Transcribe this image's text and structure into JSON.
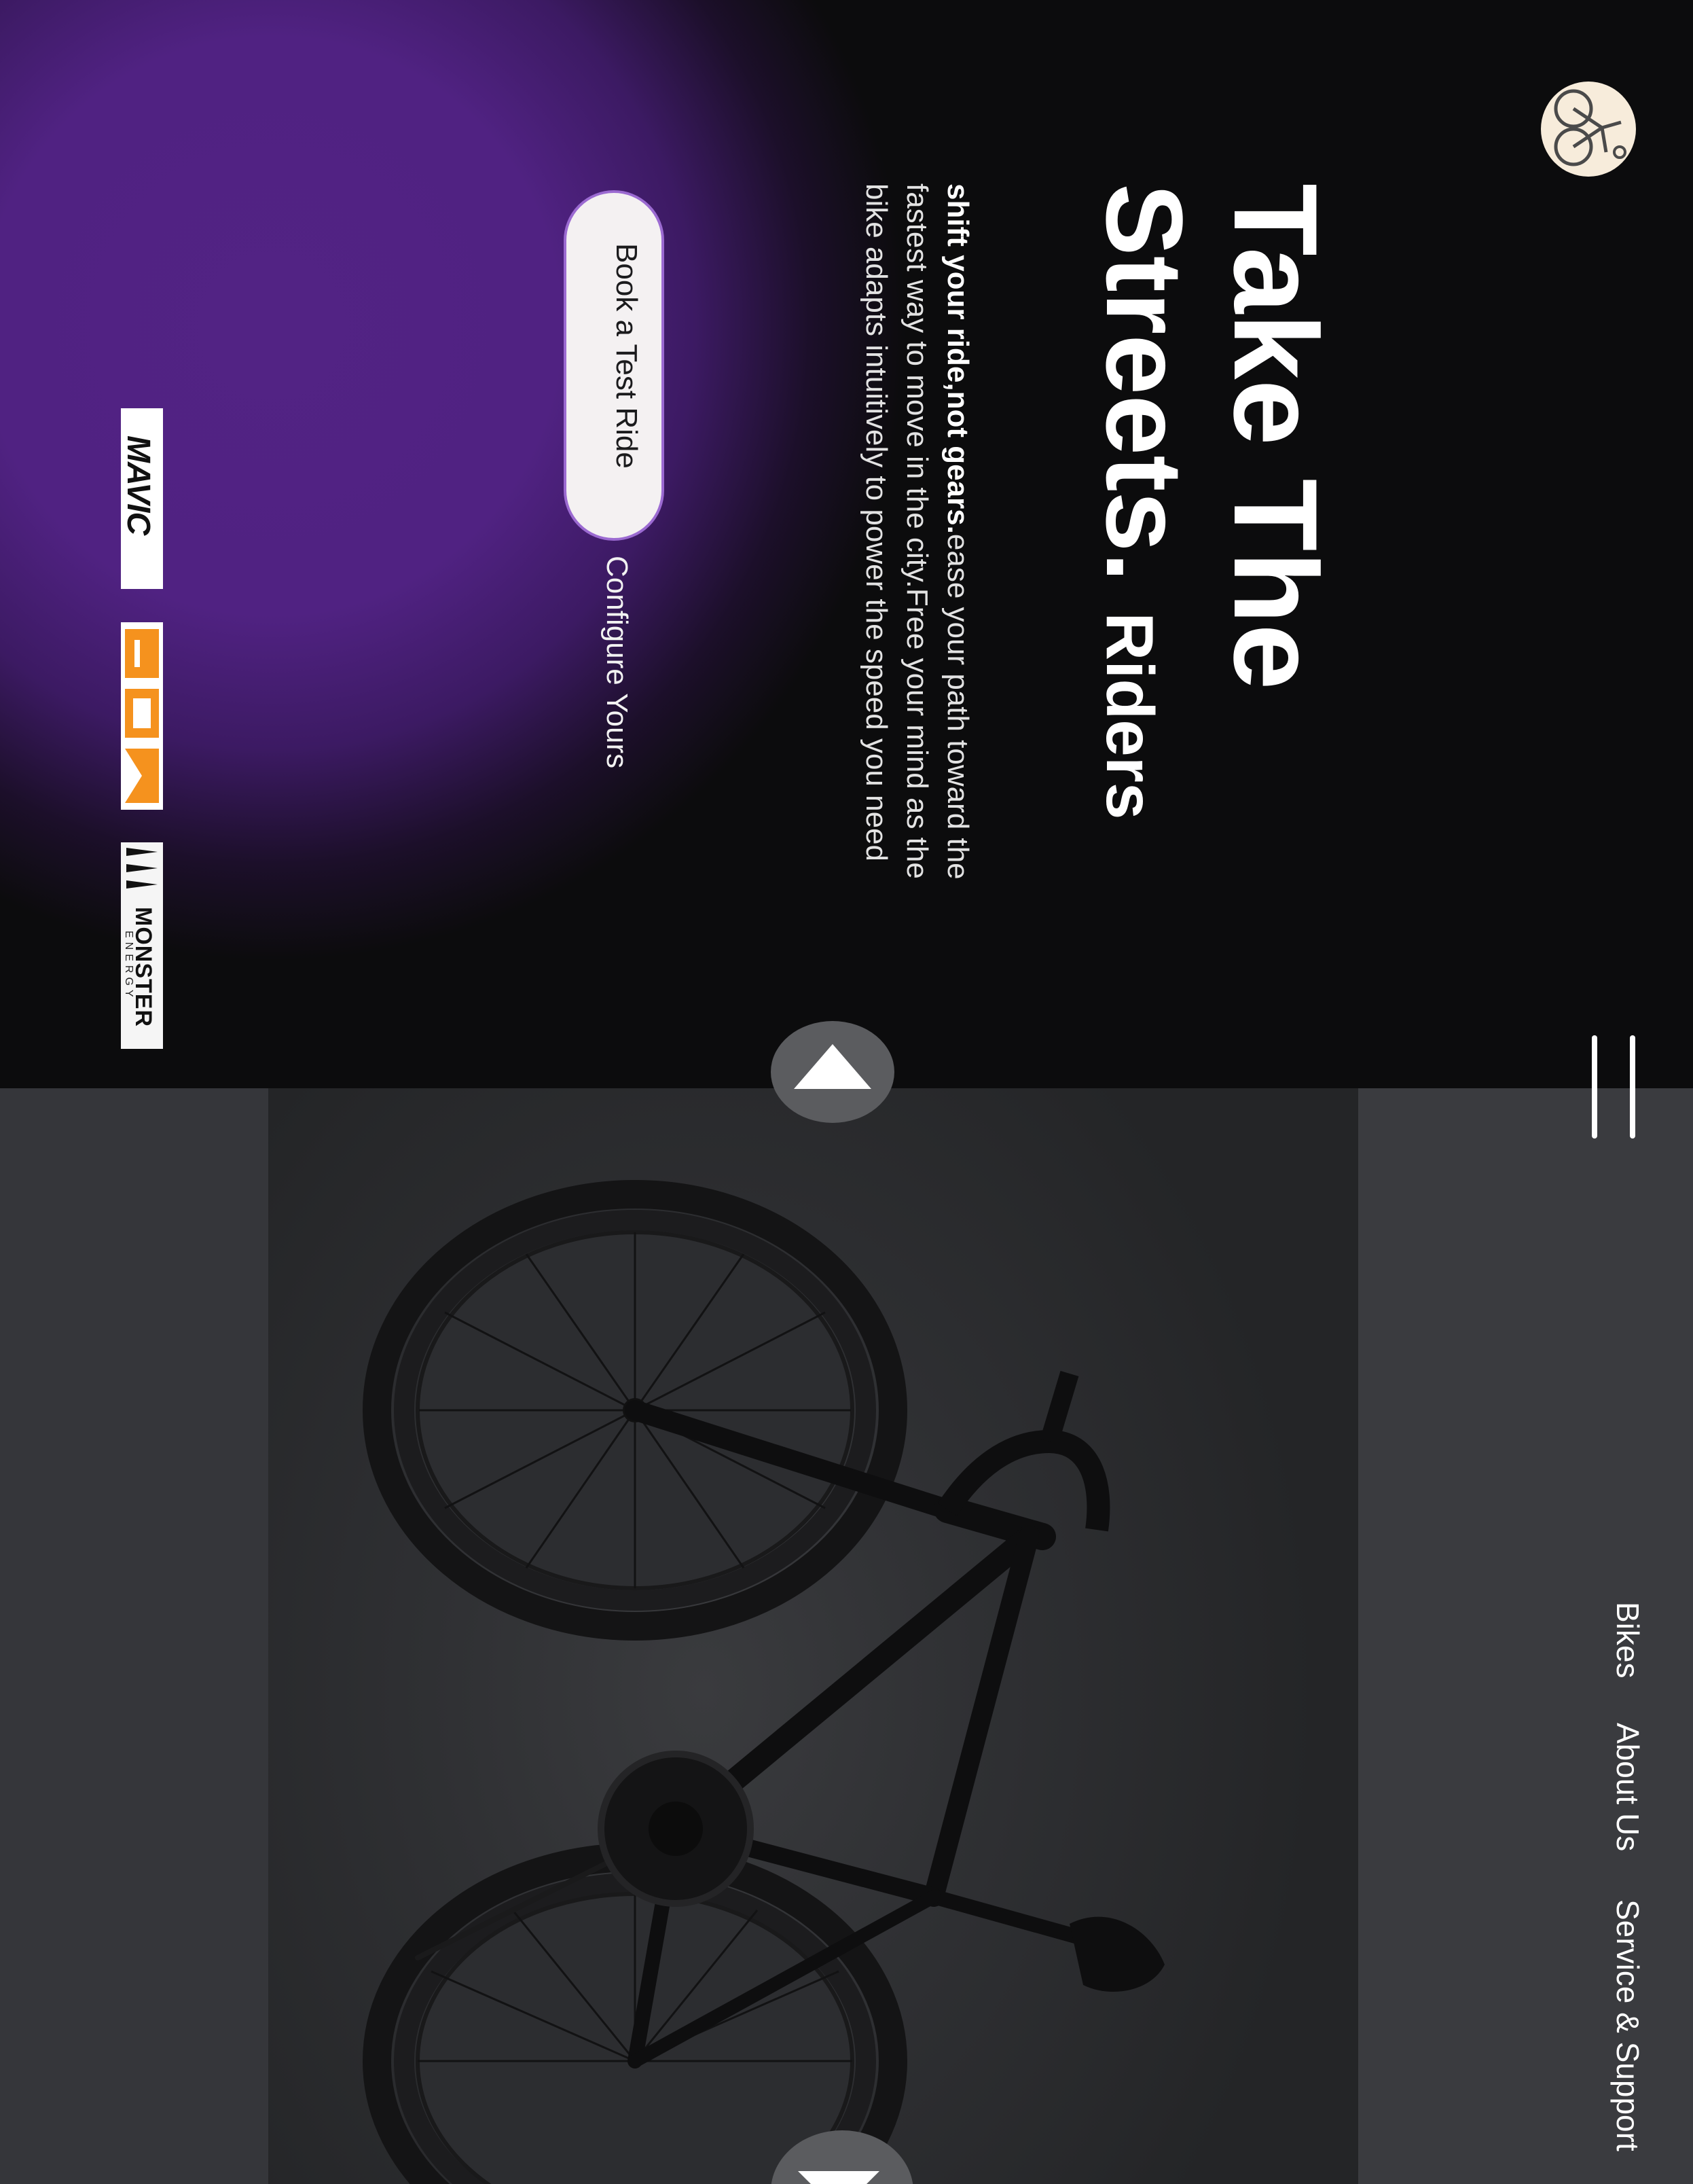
{
  "hero": {
    "title_line1": "Take The",
    "title_line2": "Streets.",
    "title_line2_small": "Riders",
    "tagline_strong": "shift your ride,not gears.",
    "tagline_rest": "ease your path toward the fastest way to move in the city.Free your mind as the bike adapts intuitively to power the speed you need"
  },
  "cta": {
    "primary_label": "Book a Test Ride",
    "secondary_label": "Configure Yours"
  },
  "brands": [
    {
      "name": "MAVIC",
      "icon": "mavic-logo"
    },
    {
      "name": "FOX",
      "icon": "fox-logo"
    },
    {
      "name": "MONSTER",
      "sub": "ENERGY",
      "icon": "monster-energy-logo"
    }
  ],
  "nav": {
    "items": [
      "Bikes",
      "About Us",
      "Service & Support"
    ],
    "menu_icon": "hamburger-icon"
  },
  "colors": {
    "background": "#0c0c0d",
    "accent_purple": "#522384",
    "panel_gray": "#35363a",
    "logo_badge": "#f7ecdb",
    "fox_orange": "#f5921e"
  },
  "slider": {
    "prev_icon": "triangle-up-icon",
    "next_icon": "triangle-down-icon"
  }
}
